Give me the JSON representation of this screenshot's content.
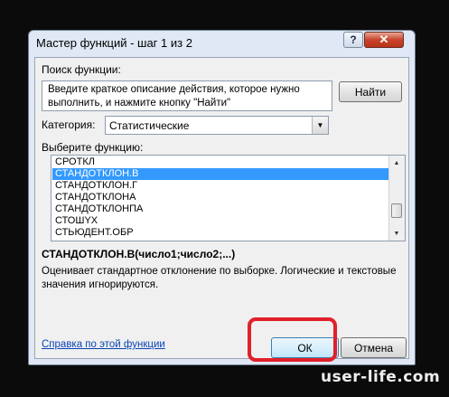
{
  "window": {
    "title": "Мастер функций - шаг 1 из 2",
    "help_icon": "?",
    "close_icon": "✕"
  },
  "search": {
    "label": "Поиск функции:",
    "description": "Введите краткое описание действия, которое нужно выполнить, и нажмите кнопку \"Найти\"",
    "find_button": "Найти"
  },
  "category": {
    "label": "Категория:",
    "selected": "Статистические"
  },
  "function_list": {
    "label": "Выберите функцию:",
    "items": [
      "СРОТКЛ",
      "СТАНДОТКЛОН.В",
      "СТАНДОТКЛОН.Г",
      "СТАНДОТКЛОНА",
      "СТАНДОТКЛОНПА",
      "СТОШYX",
      "СТЬЮДЕНТ.ОБР"
    ],
    "selected_index": 1
  },
  "details": {
    "signature": "СТАНДОТКЛОН.В(число1;число2;...)",
    "description": "Оценивает стандартное отклонение по выборке. Логические и текстовые значения игнорируются."
  },
  "footer": {
    "help_link": "Справка по этой функции",
    "ok_label": "ОК",
    "cancel_label": "Отмена"
  },
  "watermark": "user-life.com",
  "colors": {
    "selection": "#3399ff",
    "highlight_ring": "#e0202a",
    "link": "#0a44b5"
  }
}
